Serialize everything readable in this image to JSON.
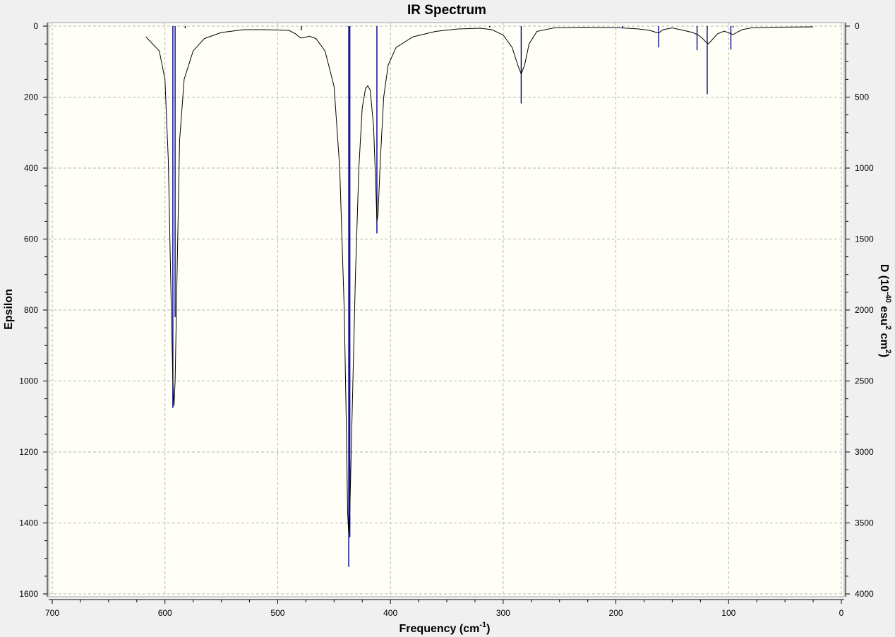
{
  "colors": {
    "plot_background": "#fffff7",
    "window_background": "#f0f0f0",
    "spectrum_line": "#000000",
    "stick_color": "#00008b",
    "grid_color": "#b4b4b4"
  },
  "chart_data": {
    "type": "line",
    "title": "IR Spectrum",
    "xlabel": "Frequency (cm-1)",
    "xlabel_parts": {
      "main": "Frequency (cm",
      "sup": "-1",
      "tail": ")"
    },
    "ylabel_left": "Epsilon",
    "ylabel_right": "D (10-40 esu2 cm2)",
    "ylabel_right_parts": {
      "a": "D (10",
      "sup1": "-40",
      "b": " esu",
      "sup2": "2",
      "c": " cm",
      "sup3": "2",
      "d": ")"
    },
    "xlim": [
      700,
      0
    ],
    "ylim_left": [
      0,
      1600
    ],
    "ylim_right": [
      0,
      4000
    ],
    "y_inverted": true,
    "grid": true,
    "x_ticks": [
      "700",
      "600",
      "500",
      "400",
      "300",
      "200",
      "100",
      "0"
    ],
    "y_left_ticks": [
      "0",
      "200",
      "400",
      "600",
      "800",
      "1000",
      "1200",
      "1400",
      "1600"
    ],
    "y_right_ticks": [
      "0",
      "500",
      "1000",
      "1500",
      "2000",
      "2500",
      "3000",
      "3500",
      "4000"
    ],
    "series": [
      {
        "values": [
          [
            617,
            30
          ],
          [
            605,
            70
          ],
          [
            600,
            150
          ],
          [
            597,
            380
          ],
          [
            595,
            700
          ],
          [
            593,
            1000
          ],
          [
            592,
            1070
          ],
          [
            591,
            1000
          ],
          [
            589,
            650
          ],
          [
            587,
            320
          ],
          [
            583,
            150
          ],
          [
            575,
            70
          ],
          [
            565,
            35
          ],
          [
            550,
            18
          ],
          [
            530,
            10
          ],
          [
            510,
            10
          ],
          [
            490,
            12
          ],
          [
            484,
            22
          ],
          [
            480,
            33
          ],
          [
            477,
            33
          ],
          [
            472,
            28
          ],
          [
            466,
            35
          ],
          [
            458,
            70
          ],
          [
            450,
            170
          ],
          [
            445,
            400
          ],
          [
            441,
            800
          ],
          [
            439,
            1150
          ],
          [
            438,
            1370
          ],
          [
            437,
            1430
          ],
          [
            436,
            1370
          ],
          [
            434,
            1100
          ],
          [
            431,
            700
          ],
          [
            428,
            400
          ],
          [
            425,
            230
          ],
          [
            422,
            175
          ],
          [
            420,
            168
          ],
          [
            418,
            180
          ],
          [
            415,
            280
          ],
          [
            413,
            450
          ],
          [
            412,
            550
          ],
          [
            411,
            530
          ],
          [
            409,
            380
          ],
          [
            406,
            200
          ],
          [
            402,
            110
          ],
          [
            395,
            60
          ],
          [
            380,
            30
          ],
          [
            360,
            15
          ],
          [
            340,
            8
          ],
          [
            320,
            6
          ],
          [
            310,
            10
          ],
          [
            300,
            25
          ],
          [
            292,
            60
          ],
          [
            287,
            110
          ],
          [
            284,
            135
          ],
          [
            281,
            110
          ],
          [
            277,
            50
          ],
          [
            270,
            15
          ],
          [
            255,
            5
          ],
          [
            230,
            3
          ],
          [
            200,
            4
          ],
          [
            180,
            8
          ],
          [
            170,
            12
          ],
          [
            164,
            18
          ],
          [
            162,
            19
          ],
          [
            158,
            10
          ],
          [
            150,
            5
          ],
          [
            140,
            12
          ],
          [
            132,
            18
          ],
          [
            127,
            25
          ],
          [
            124,
            32
          ],
          [
            120,
            45
          ],
          [
            118,
            50
          ],
          [
            115,
            40
          ],
          [
            110,
            22
          ],
          [
            104,
            14
          ],
          [
            99,
            20
          ],
          [
            96,
            24
          ],
          [
            93,
            18
          ],
          [
            88,
            10
          ],
          [
            80,
            5
          ],
          [
            60,
            3
          ],
          [
            25,
            2
          ]
        ]
      }
    ],
    "sticks": [
      [
        593,
        2690
      ],
      [
        591,
        2050
      ],
      [
        582,
        15
      ],
      [
        479,
        30
      ],
      [
        437,
        3810
      ],
      [
        436,
        3600
      ],
      [
        412,
        1460
      ],
      [
        312,
        8
      ],
      [
        284,
        545
      ],
      [
        194,
        15
      ],
      [
        162,
        150
      ],
      [
        128,
        170
      ],
      [
        119,
        480
      ],
      [
        98,
        165
      ],
      [
        96,
        10
      ]
    ]
  }
}
